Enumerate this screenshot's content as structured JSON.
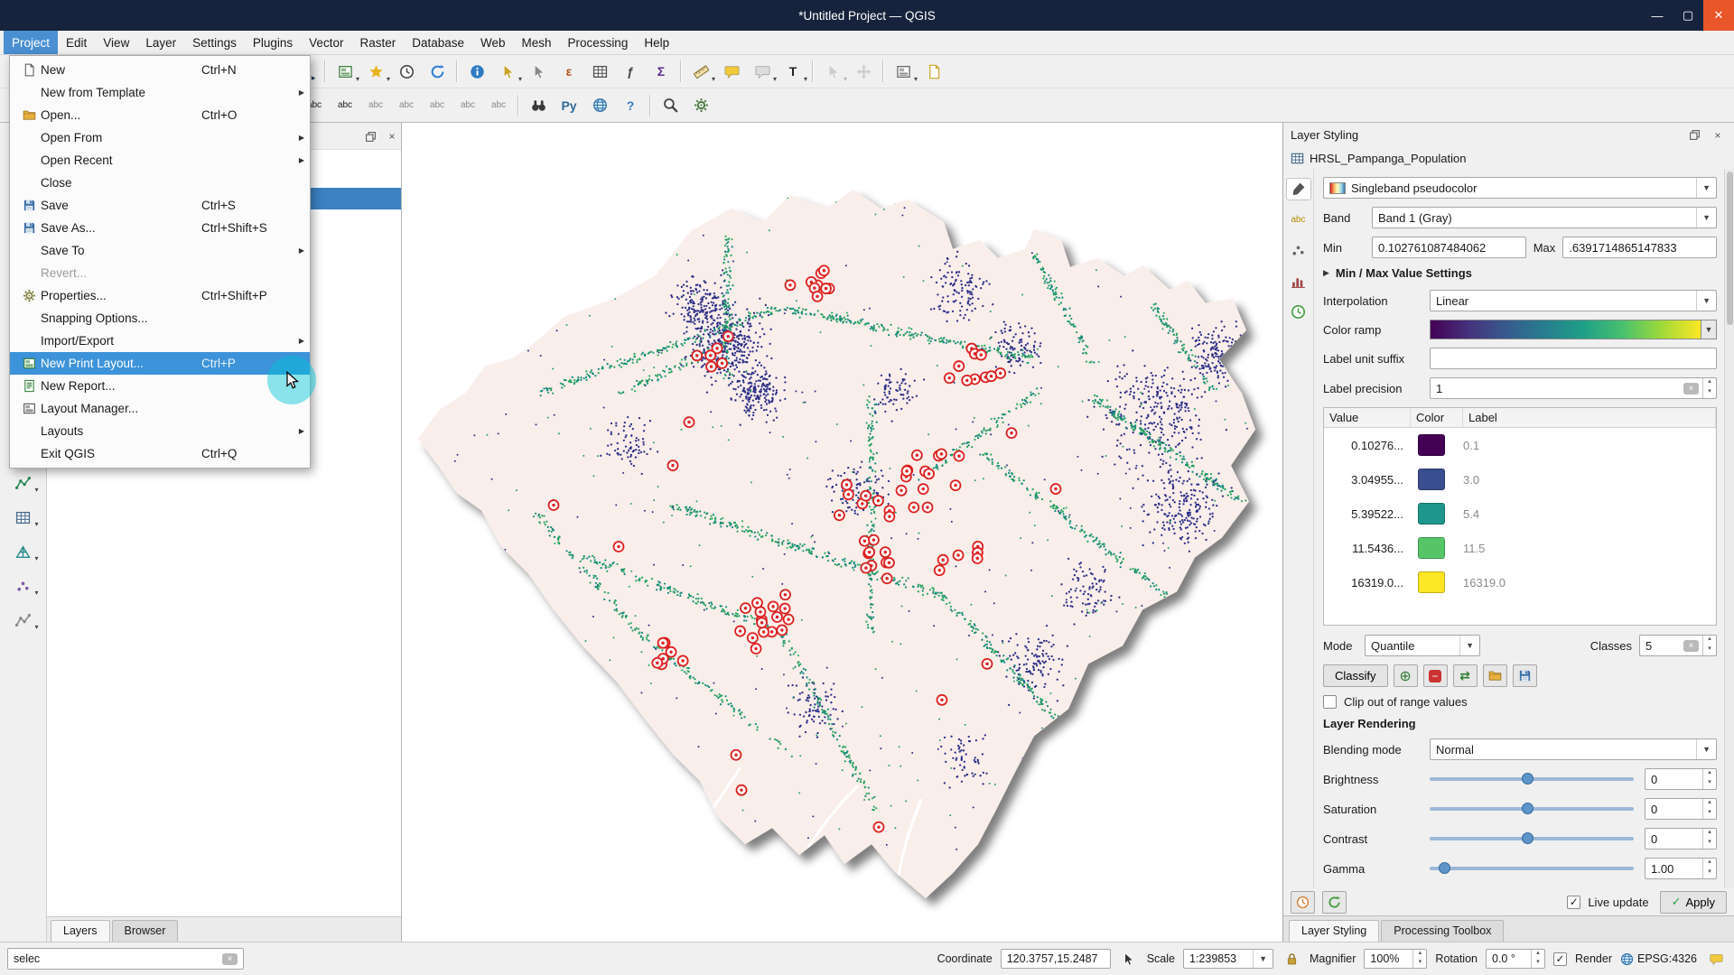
{
  "window": {
    "title": "*Untitled Project — QGIS"
  },
  "menubar": {
    "items": [
      {
        "label": "Project",
        "active": true
      },
      {
        "label": "Edit"
      },
      {
        "label": "View"
      },
      {
        "label": "Layer"
      },
      {
        "label": "Settings"
      },
      {
        "label": "Plugins"
      },
      {
        "label": "Vector"
      },
      {
        "label": "Raster"
      },
      {
        "label": "Database"
      },
      {
        "label": "Web"
      },
      {
        "label": "Mesh"
      },
      {
        "label": "Processing"
      },
      {
        "label": "Help"
      }
    ]
  },
  "project_menu": {
    "items": [
      {
        "label": "New",
        "shortcut": "Ctrl+N",
        "icon": "page",
        "tint": "#555"
      },
      {
        "label": "New from Template",
        "submenu": true
      },
      {
        "label": "Open...",
        "shortcut": "Ctrl+O",
        "icon": "folder"
      },
      {
        "label": "Open From",
        "submenu": true
      },
      {
        "label": "Open Recent",
        "submenu": true
      },
      {
        "label": "Close"
      },
      {
        "label": "Save",
        "shortcut": "Ctrl+S",
        "icon": "save"
      },
      {
        "label": "Save As...",
        "shortcut": "Ctrl+Shift+S",
        "icon": "save"
      },
      {
        "label": "Save To",
        "submenu": true
      },
      {
        "label": "Revert...",
        "disabled": true
      },
      {
        "label": "Properties...",
        "shortcut": "Ctrl+Shift+P",
        "icon": "gear",
        "tint": "#7a7a36"
      },
      {
        "label": "Snapping Options..."
      },
      {
        "label": "Import/Export",
        "submenu": true
      },
      {
        "label": "New Print Layout...",
        "shortcut": "Ctrl+P",
        "icon": "layout",
        "tint": "#2e7d32",
        "highlighted": true
      },
      {
        "label": "New Report...",
        "icon": "report",
        "tint": "#2e7d32"
      },
      {
        "label": "Layout Manager...",
        "icon": "layout",
        "tint": "#555"
      },
      {
        "label": "Layouts",
        "submenu": true
      },
      {
        "label": "Exit QGIS",
        "shortcut": "Ctrl+Q"
      }
    ]
  },
  "toolbars": {
    "row1": [
      {
        "name": "pan-map",
        "icon": "move",
        "tint": "#8a6a3e"
      },
      {
        "name": "pan-map-to-selection",
        "icon": "move",
        "tint": "#bd9a63"
      },
      {
        "sep": true
      },
      {
        "name": "zoom-in",
        "icon": "mag",
        "ov": "+",
        "tint": "#444"
      },
      {
        "name": "zoom-out",
        "icon": "mag",
        "ov": "−",
        "tint": "#444"
      },
      {
        "name": "zoom-native",
        "icon": "mag",
        "ov": "1:1",
        "tint": "#444"
      },
      {
        "name": "zoom-full",
        "icon": "mag",
        "ov": "□",
        "tint": "#444"
      },
      {
        "name": "zoom-to-selection",
        "icon": "mag",
        "ov": "▪",
        "tint": "#444"
      },
      {
        "name": "zoom-to-layer",
        "icon": "mag",
        "ov": "▤",
        "tint": "#444"
      },
      {
        "name": "zoom-last",
        "icon": "mag",
        "ov": "◂",
        "tint": "#444"
      },
      {
        "name": "zoom-next",
        "icon": "mag",
        "ov": "▸",
        "tint": "#444"
      },
      {
        "sep": true
      },
      {
        "name": "new-map-view",
        "icon": "layout",
        "tint": "#3b7d3b",
        "caret": true
      },
      {
        "name": "spatial-bookmarks",
        "icon": "star",
        "caret": true
      },
      {
        "name": "temporal-controller",
        "icon": "clock",
        "tint": "#444"
      },
      {
        "name": "refresh-map",
        "icon": "refresh",
        "tint": "#2e7dd1"
      },
      {
        "sep": true
      },
      {
        "name": "identify-features",
        "icon": "info"
      },
      {
        "name": "select-features",
        "icon": "cursor",
        "tint": "#c9a227",
        "caret": true
      },
      {
        "name": "deselect-features",
        "icon": "cursor",
        "tint": "#888"
      },
      {
        "name": "select-by-expression",
        "text": "ε",
        "tint": "#b3541e",
        "bold": true
      },
      {
        "name": "open-attribute-table",
        "icon": "table",
        "tint": "#555"
      },
      {
        "name": "field-calculator",
        "text": "ƒ",
        "tint": "#444",
        "bold": true
      },
      {
        "name": "statistical-summary",
        "text": "Σ",
        "tint": "#5b2d8e",
        "bold": true
      },
      {
        "sep": true
      },
      {
        "name": "measure",
        "icon": "ruler",
        "caret": true
      },
      {
        "name": "map-tips",
        "icon": "bubble",
        "tint": "#f0c93c"
      },
      {
        "name": "new-annotation",
        "icon": "bubble",
        "tint": "#dcdcdc",
        "caret": true
      },
      {
        "name": "text-annotation",
        "text": "T",
        "tint": "#222",
        "bold": true,
        "caret": true
      },
      {
        "sep": true
      },
      {
        "name": "select-features-by-value",
        "icon": "cursor",
        "tint": "#888",
        "disabled": true,
        "caret": true
      },
      {
        "name": "move-feature",
        "icon": "move",
        "tint": "#888",
        "disabled": true
      },
      {
        "sep": true
      },
      {
        "name": "decorations",
        "icon": "layout",
        "tint": "#666",
        "caret": true
      },
      {
        "name": "project-notes",
        "icon": "page",
        "tint": "#c9a227"
      }
    ],
    "row2": [
      {
        "name": "current-edits",
        "icon": "pencil",
        "tint": "#8a8a8a",
        "disabled": true,
        "caret": true
      },
      {
        "name": "toggle-editing",
        "icon": "pencil",
        "tint": "#c9a227",
        "disabled": true
      },
      {
        "name": "save-layer-edits",
        "icon": "save",
        "disabled": true
      },
      {
        "sep": true
      },
      {
        "name": "add-feature",
        "icon": "dots",
        "tint": "#2e7d32",
        "disabled": true
      },
      {
        "name": "vertex-tool",
        "icon": "vector",
        "tint": "#555",
        "disabled": true,
        "caret": true
      },
      {
        "name": "delete-selected",
        "text": "×",
        "tint": "#b23030",
        "bold": true,
        "disabled": true
      },
      {
        "name": "cut-features",
        "text": "✂",
        "tint": "#555",
        "disabled": true
      },
      {
        "name": "copy-features",
        "icon": "page",
        "tint": "#777",
        "disabled": true
      },
      {
        "name": "paste-features",
        "icon": "page",
        "tint": "#777",
        "disabled": true
      },
      {
        "sep": true
      },
      {
        "name": "layer-labeling",
        "text": "abc",
        "tint": "#1a1a1a",
        "small": true
      },
      {
        "name": "layer-diagram",
        "text": "abc",
        "tint": "#1a1a1a",
        "small": true
      },
      {
        "name": "pin-labels",
        "text": "abc",
        "tint": "#888",
        "small": true
      },
      {
        "name": "highlight-pinned-labels",
        "text": "abc",
        "tint": "#888",
        "small": true
      },
      {
        "name": "move-label",
        "text": "abc",
        "tint": "#888",
        "small": true
      },
      {
        "name": "rotate-label",
        "text": "abc",
        "tint": "#888",
        "small": true
      },
      {
        "name": "change-label",
        "text": "abc",
        "tint": "#888",
        "small": true
      },
      {
        "sep": true
      },
      {
        "name": "osm-place-search",
        "icon": "binoc",
        "tint": "#3a3a3a"
      },
      {
        "name": "python-console",
        "text": "Py",
        "tint": "#306998",
        "bold": true
      },
      {
        "name": "quickmap-services",
        "icon": "globe"
      },
      {
        "name": "help-contents",
        "text": "?",
        "tint": "#2f7cc4",
        "bold": true
      },
      {
        "sep": true
      },
      {
        "name": "locator-search",
        "icon": "mag",
        "tint": "#444"
      },
      {
        "name": "grass-tools",
        "icon": "gear",
        "tint": "#4d7c43"
      }
    ]
  },
  "left_dock": {
    "buttons": [
      {
        "name": "add-vector-layer",
        "icon": "vector",
        "tint": "#2e8b57",
        "caret": true
      },
      {
        "name": "add-raster-layer",
        "icon": "table",
        "tint": "#4a6d8c",
        "caret": true
      },
      {
        "name": "add-mesh-layer",
        "icon": "mesh",
        "tint": "#2a8c8c",
        "caret": true
      },
      {
        "name": "add-point-cloud-layer",
        "icon": "dots",
        "tint": "#7d5ba6",
        "caret": true
      },
      {
        "name": "add-virtual-layer",
        "icon": "vector",
        "tint": "#888",
        "caret": true
      }
    ]
  },
  "layers_panel": {
    "toolbar": [
      {
        "name": "open-layer-styling",
        "icon": "brush",
        "tint": "#7d3f98"
      },
      {
        "name": "add-group",
        "icon": "folder"
      },
      {
        "name": "manage-map-themes",
        "text": "≡",
        "tint": "#555",
        "caret": true
      },
      {
        "name": "filter-legend",
        "text": "▽",
        "tint": "#555",
        "caret": true
      },
      {
        "name": "expand-all",
        "text": "+",
        "tint": "#555",
        "bold": true
      },
      {
        "name": "collapse-all",
        "text": "−",
        "tint": "#555",
        "bold": true
      },
      {
        "name": "remove-layer",
        "text": "×",
        "tint": "#555",
        "bold": true
      }
    ],
    "selected_layer": "HRSL_Pampanga_Population",
    "tabs": [
      {
        "label": "Layers",
        "active": true
      },
      {
        "label": "Browser"
      }
    ]
  },
  "styling": {
    "header": "Layer Styling",
    "layer_name": "HRSL_Pampanga_Population",
    "tools": [
      {
        "name": "symbology",
        "icon": "brush",
        "tint": "#555",
        "active": true
      },
      {
        "name": "labels",
        "text": "abc",
        "tint": "#b58a00",
        "small": true
      },
      {
        "name": "transparency",
        "icon": "dots",
        "tint": "#666"
      },
      {
        "name": "histogram",
        "icon": "hist",
        "tint": "#a04545"
      },
      {
        "name": "history",
        "icon": "clock",
        "tint": "#3f9c3f"
      }
    ],
    "render_type": "Singleband pseudocolor",
    "band_label": "Band",
    "band_value": "Band 1 (Gray)",
    "min_label": "Min",
    "min_value": "0.102761087484062",
    "max_label": "Max",
    "max_value": ".6391714865147833",
    "minmax_section": "Min / Max Value Settings",
    "interpolation_label": "Interpolation",
    "interpolation_value": "Linear",
    "ramp_label": "Color ramp",
    "suffix_label": "Label unit suffix",
    "precision_label": "Label precision",
    "precision_value": "1",
    "classification": {
      "headers": [
        "Value",
        "Color",
        "Label"
      ],
      "rows": [
        {
          "value": "0.10276...",
          "color": "#440154",
          "label": "0.1"
        },
        {
          "value": "3.04955...",
          "color": "#3b4e8f",
          "label": "3.0"
        },
        {
          "value": "5.39522...",
          "color": "#1f968b",
          "label": "5.4"
        },
        {
          "value": "11.5436...",
          "color": "#55c567",
          "label": "11.5"
        },
        {
          "value": "16319.0...",
          "color": "#fde725",
          "label": "16319.0"
        }
      ]
    },
    "mode_label": "Mode",
    "mode_value": "Quantile",
    "classes_label": "Classes",
    "classes_value": "5",
    "classify_label": "Classify",
    "clip_label": "Clip out of range values",
    "rendering_title": "Layer Rendering",
    "blending_label": "Blending mode",
    "blending_value": "Normal",
    "sliders": [
      {
        "label": "Brightness",
        "value": "0",
        "pos": 48
      },
      {
        "label": "Saturation",
        "value": "0",
        "pos": 48
      },
      {
        "label": "Contrast",
        "value": "0",
        "pos": 48
      },
      {
        "label": "Gamma",
        "value": "1.00",
        "pos": 7
      }
    ],
    "live_update_label": "Live update",
    "apply_label": "Apply",
    "tabs": [
      {
        "label": "Layer Styling",
        "active": true
      },
      {
        "label": "Processing Toolbox"
      }
    ]
  },
  "statusbar": {
    "locator_value": "selec",
    "coordinate_label": "Coordinate",
    "coordinate_value": "120.3757,15.2487",
    "scale_label": "Scale",
    "scale_value": "1:239853",
    "magnifier_label": "Magnifier",
    "magnifier_value": "100%",
    "rotation_label": "Rotation",
    "rotation_value": "0.0 °",
    "render_label": "Render",
    "crs": "EPSG:4326"
  },
  "map": {
    "canvas_bg": "#ffffff",
    "land_color": "#f9eeea",
    "dot_colors": [
      "#2c2f87",
      "#27a35f",
      "#12897a"
    ],
    "marker_color": "#dd2020",
    "shadow_opacity": 0.5
  }
}
